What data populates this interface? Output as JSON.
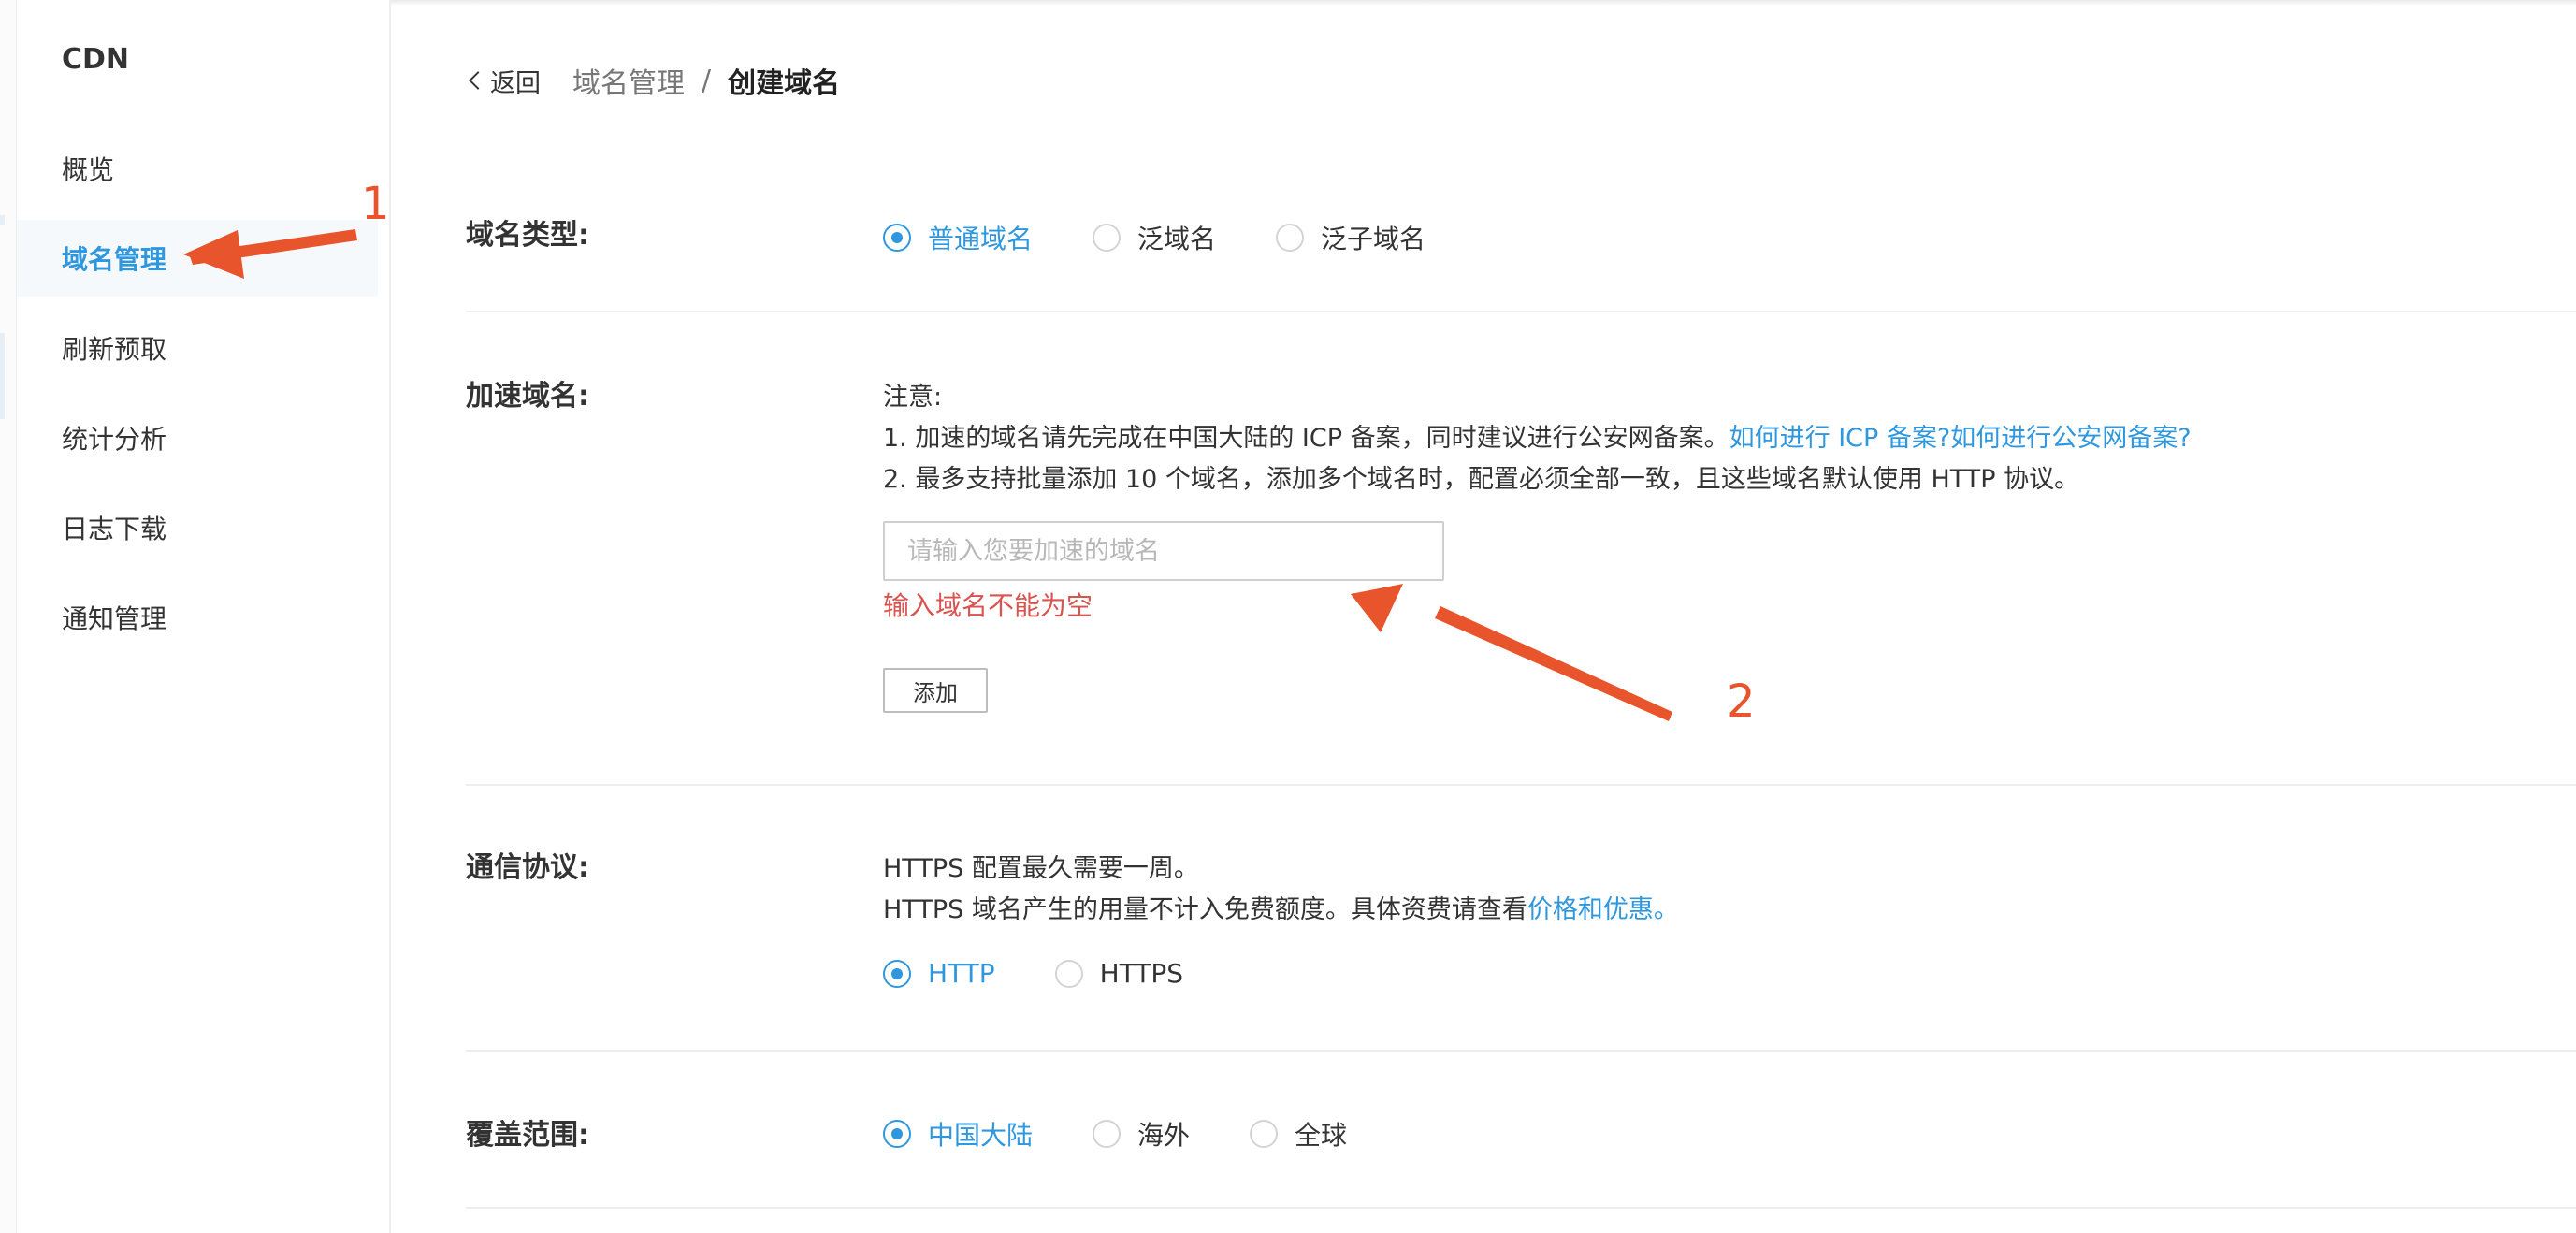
{
  "sidebar": {
    "title": "CDN",
    "items": [
      {
        "label": "概览",
        "active": false
      },
      {
        "label": "域名管理",
        "active": true
      },
      {
        "label": "刷新预取",
        "active": false
      },
      {
        "label": "统计分析",
        "active": false
      },
      {
        "label": "日志下载",
        "active": false
      },
      {
        "label": "通知管理",
        "active": false
      }
    ]
  },
  "breadcrumb": {
    "back": "返回",
    "parent": "域名管理",
    "separator": "/",
    "current": "创建域名"
  },
  "domain_type": {
    "label": "域名类型:",
    "options": [
      "普通域名",
      "泛域名",
      "泛子域名"
    ],
    "selected": "普通域名"
  },
  "accelerated_domain": {
    "label": "加速域名:",
    "note_title": "注意:",
    "note_1": "1. 加速的域名请先完成在中国大陆的 ICP 备案，同时建议进行公安网备案。",
    "note_1_link_icp": "如何进行 ICP 备案?",
    "note_1_link_police": "如何进行公安网备案?",
    "note_2": "2. 最多支持批量添加 10 个域名，添加多个域名时，配置必须全部一致，且这些域名默认使用 HTTP 协议。",
    "input_placeholder": "请输入您要加速的域名",
    "input_value": "",
    "error": "输入域名不能为空",
    "add_button": "添加"
  },
  "protocol": {
    "label": "通信协议:",
    "line_1": "HTTPS 配置最久需要一周。",
    "line_2": "HTTPS 域名产生的用量不计入免费额度。具体资费请查看",
    "line_2_link": "价格和优惠。",
    "options": [
      "HTTP",
      "HTTPS"
    ],
    "selected": "HTTP"
  },
  "coverage": {
    "label": "覆盖范围:",
    "options": [
      "中国大陆",
      "海外",
      "全球"
    ],
    "selected": "中国大陆"
  },
  "annotations": {
    "one": "1",
    "two": "2",
    "color": "#e8542b"
  },
  "colors": {
    "accent": "#2f97de",
    "error": "#d9534f"
  }
}
